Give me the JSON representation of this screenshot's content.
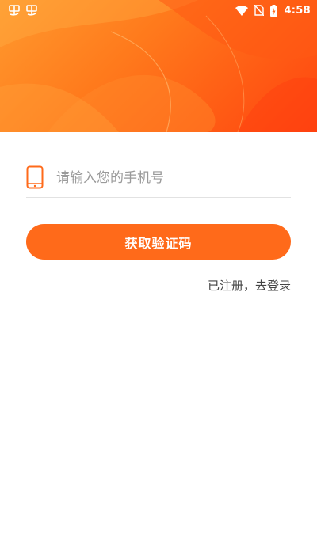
{
  "status_bar": {
    "time": "4:58",
    "left_glyphs": [
      "虫",
      "虫"
    ]
  },
  "form": {
    "phone_placeholder": "请输入您的手机号",
    "phone_value": "",
    "get_code_label": "获取验证码",
    "login_link": "已注册，去登录"
  },
  "colors": {
    "accent": "#ff6a1a",
    "header_light": "#ff9a2e",
    "header_dark": "#ff4410"
  }
}
